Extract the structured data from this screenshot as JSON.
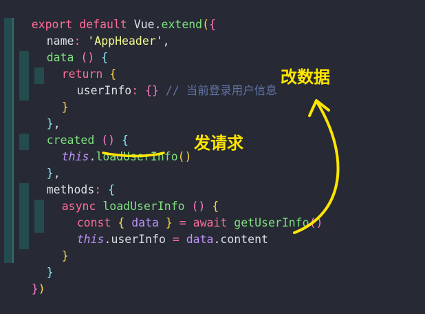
{
  "colors": {
    "background": "#272a35",
    "keyword": "#ff6e9a",
    "function": "#7ee07e",
    "string": "#f1fa8c",
    "property": "#8be9fd",
    "brace1": "#ffd54a",
    "brace2": "#ff79c6",
    "this": "#bd93f9",
    "comment": "#6272a4",
    "text": "#dcdfe4",
    "annotation": "#ffe600"
  },
  "code": {
    "line1": {
      "kw": "export default ",
      "cls": "Vue",
      "dot": ".",
      "fn": "extend",
      "paren": "(",
      "brace": "{"
    },
    "line2": {
      "prop": "name",
      "colon": ": ",
      "str": "'AppHeader'",
      "comma": ","
    },
    "line3": {
      "prop": "data",
      "rest": " () ",
      "brace": "{"
    },
    "line4": {
      "kw": "return ",
      "brace": "{"
    },
    "line5": {
      "prop": "userInfo",
      "colon": ": ",
      "obj": "{}",
      "comment": " // 当前登录用户信息"
    },
    "line6": {
      "brace": "}"
    },
    "line7": {
      "brace": "}",
      "comma": ","
    },
    "line8": {
      "prop": "created",
      "rest": " () ",
      "brace": "{"
    },
    "line9": {
      "this": "this",
      "dot": ".",
      "fn": "loadUserInfo",
      "call": "()"
    },
    "line10": {
      "brace": "}",
      "comma": ","
    },
    "line11": {
      "prop": "methods",
      "colon": ": ",
      "brace": "{"
    },
    "line12": {
      "kw": "async ",
      "fn": "loadUserInfo",
      "rest": " () ",
      "brace": "{"
    },
    "line13": {
      "kw": "const ",
      "brace1": "{ ",
      "var": "data",
      "brace2": " }",
      "eq": " = ",
      "kw2": "await ",
      "fn": "getUserInfo",
      "call": "()"
    },
    "line14": {
      "this": "this",
      "dot": ".",
      "prop": "userInfo",
      "eq": " = ",
      "var": "data",
      "dot2": ".",
      "prop2": "content"
    },
    "line15": {
      "brace": "}"
    },
    "line16": {
      "brace": "}"
    },
    "line17": {
      "brace": "}",
      "paren": ")"
    }
  },
  "annotations": {
    "change_data": "改数据",
    "send_request": "发请求"
  }
}
